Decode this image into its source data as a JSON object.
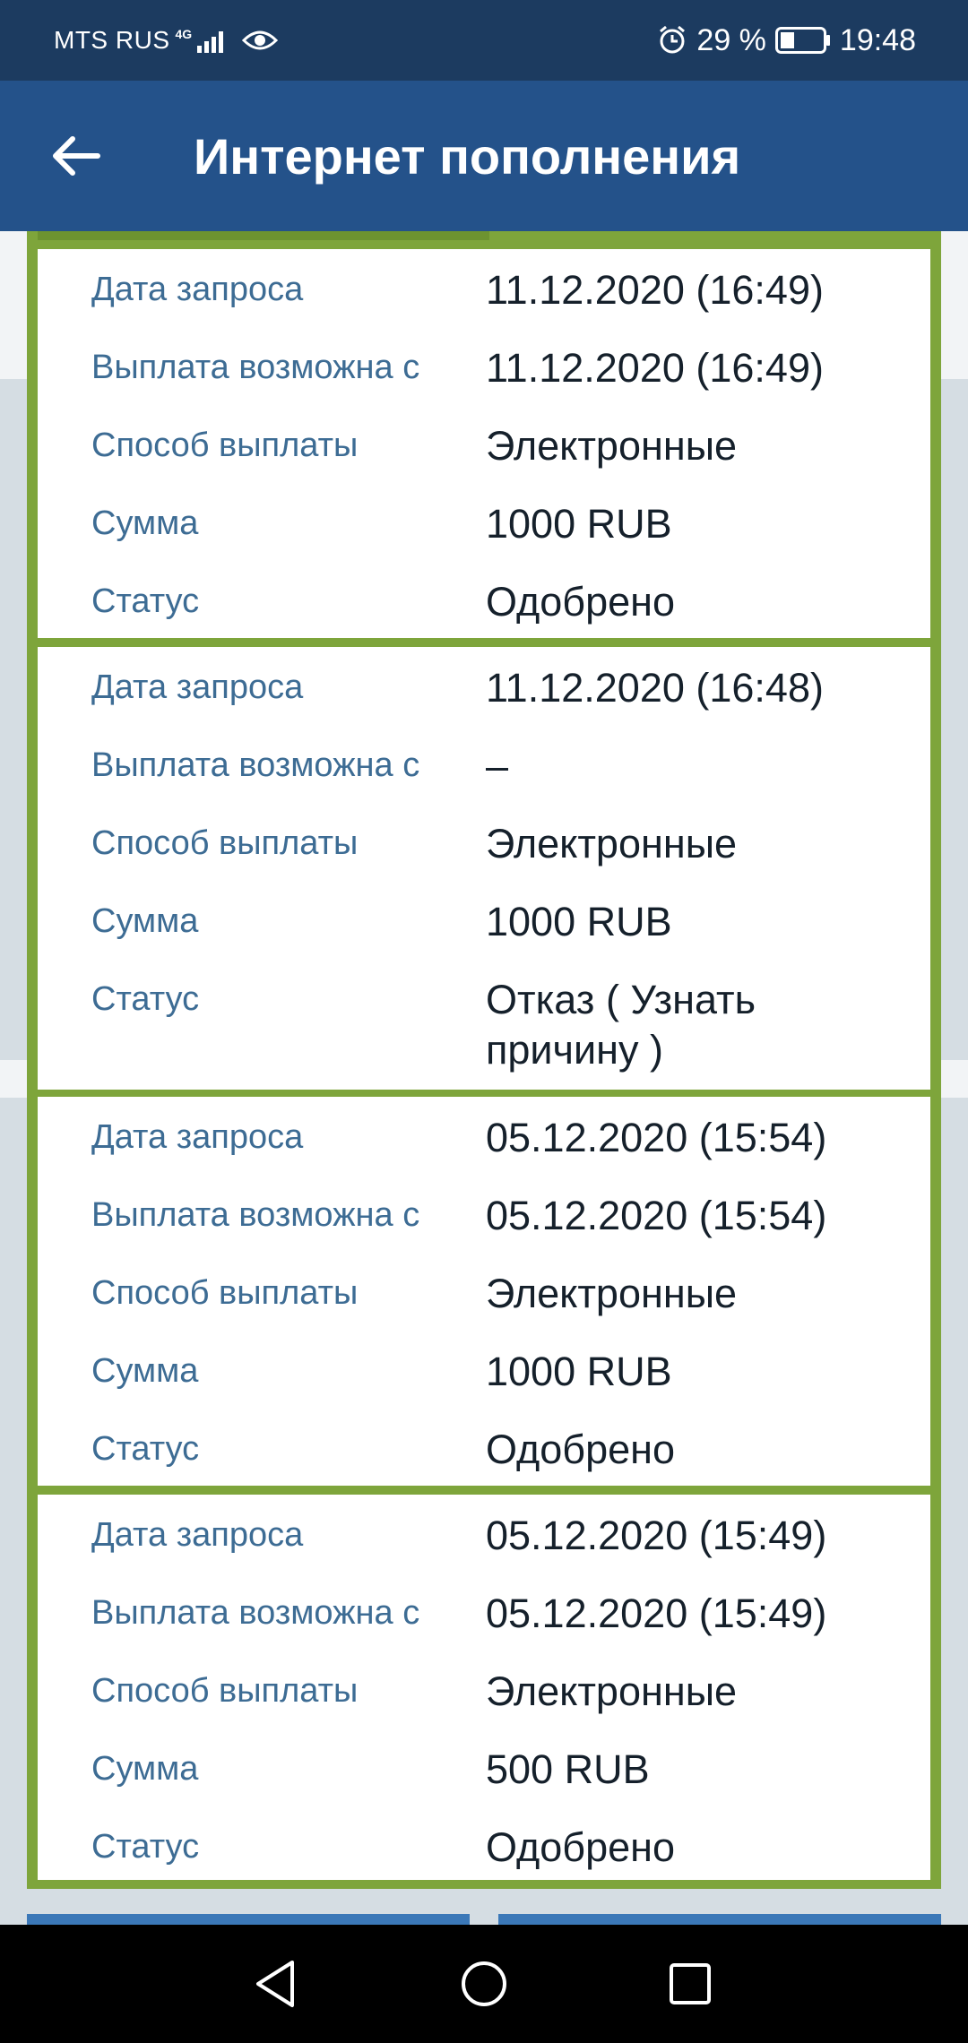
{
  "status_bar": {
    "carrier": "MTS RUS",
    "network": "4G",
    "battery": "29 %",
    "time": "19:48",
    "icons": [
      "signal-icon",
      "eye-icon",
      "alarm-icon",
      "battery-icon"
    ]
  },
  "header": {
    "title": "Интернет пополнения",
    "back_icon": "arrow-left-icon"
  },
  "colors": {
    "status_bar": "#1c3b60",
    "header": "#24528a",
    "frame_green": "#7ea53b",
    "label_blue": "#3d6c94"
  },
  "labels": {
    "date": "Дата запроса",
    "payout_from": "Выплата возможна с",
    "method": "Способ выплаты",
    "amount": "Сумма",
    "status": "Статус"
  },
  "records": [
    {
      "date": "11.12.2020 (16:49)",
      "payout_from": "11.12.2020 (16:49)",
      "method": "Электронные",
      "amount": "1000 RUB",
      "status": "Одобрено"
    },
    {
      "date": "11.12.2020 (16:48)",
      "payout_from": "–",
      "method": "Электронные",
      "amount": "1000 RUB",
      "status": "Отказ ( Узнать причину )"
    },
    {
      "date": "05.12.2020 (15:54)",
      "payout_from": "05.12.2020 (15:54)",
      "method": "Электронные",
      "amount": "1000 RUB",
      "status": "Одобрено"
    },
    {
      "date": "05.12.2020 (15:49)",
      "payout_from": "05.12.2020 (15:49)",
      "method": "Электронные",
      "amount": "500 RUB",
      "status": "Одобрено"
    }
  ],
  "nav_bar": {
    "icons": [
      "back-triangle-icon",
      "home-circle-icon",
      "recents-square-icon"
    ]
  }
}
